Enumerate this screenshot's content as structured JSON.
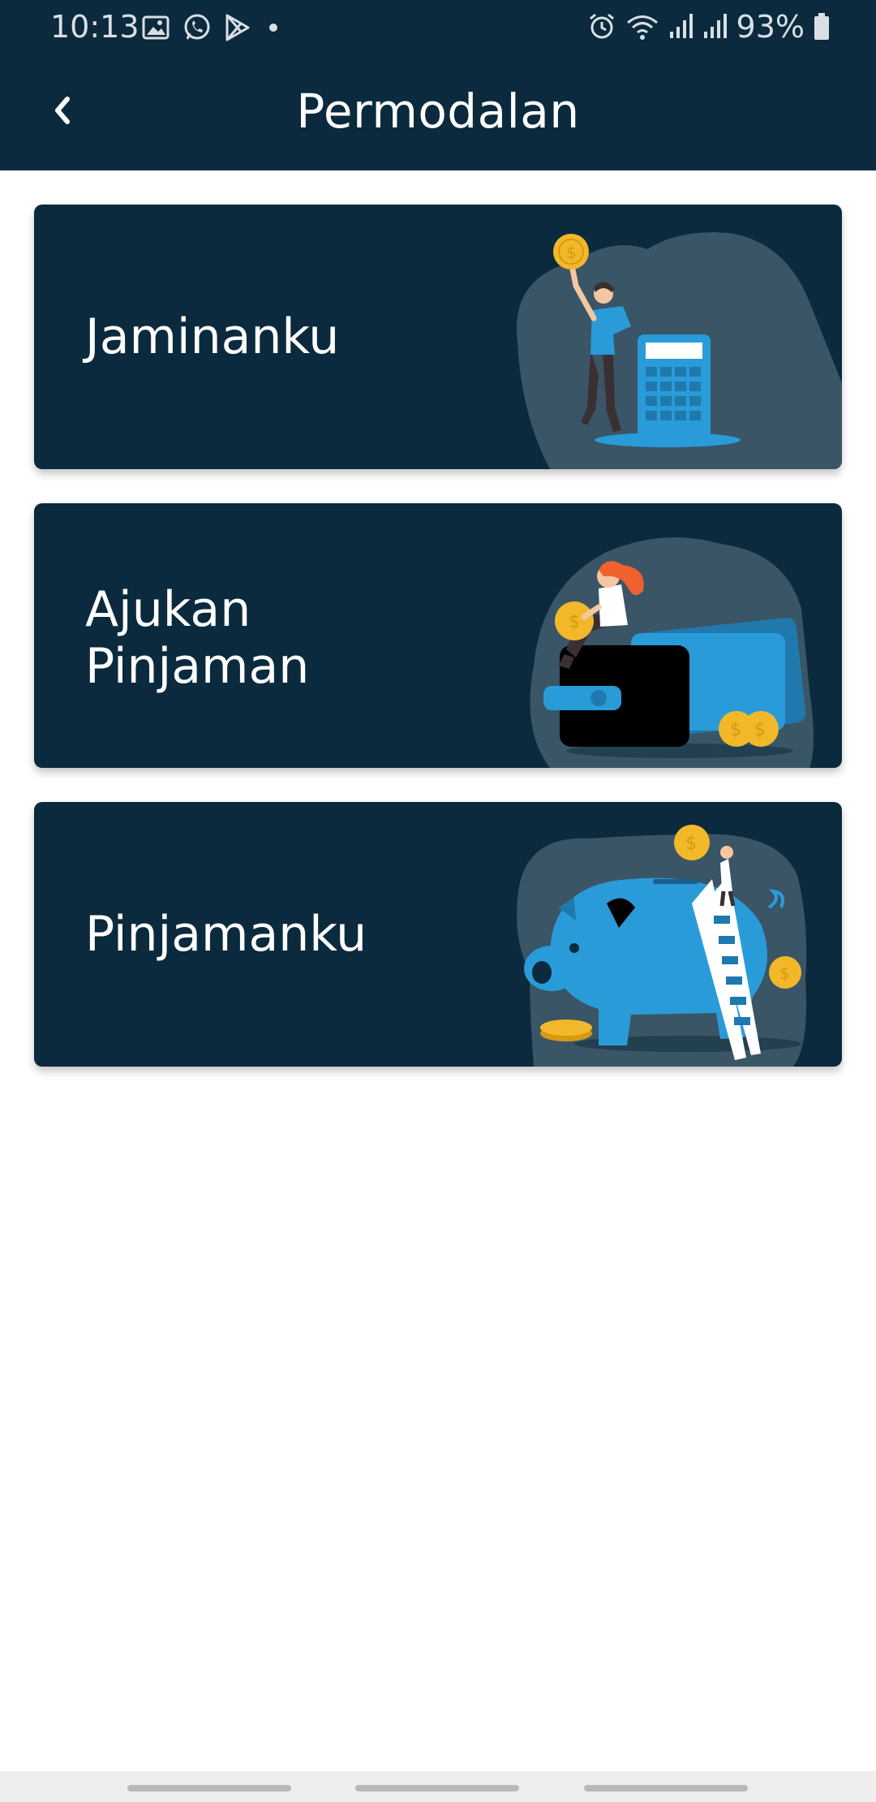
{
  "status_bar": {
    "time": "10:13",
    "battery": "93%",
    "left_icons": [
      "gallery-icon",
      "whatsapp-icon",
      "play-store-icon",
      "dot-icon"
    ],
    "right_icons": [
      "alarm-icon",
      "wifi-icon",
      "signal-icon",
      "signal-icon",
      "battery-icon"
    ]
  },
  "header": {
    "title": "Permodalan",
    "back_icon": "chevron-left-icon"
  },
  "menu": {
    "items": [
      {
        "label": "Jaminanku",
        "illustration": "calculator-illustration"
      },
      {
        "label": "Ajukan\nPinjaman",
        "illustration": "wallet-illustration"
      },
      {
        "label": "Pinjamanku",
        "illustration": "piggy-bank-illustration"
      }
    ]
  },
  "colors": {
    "primary": "#0b2a3d",
    "accent_blue": "#2a9bd9",
    "coin": "#f3b82a",
    "blob": "#395566"
  }
}
